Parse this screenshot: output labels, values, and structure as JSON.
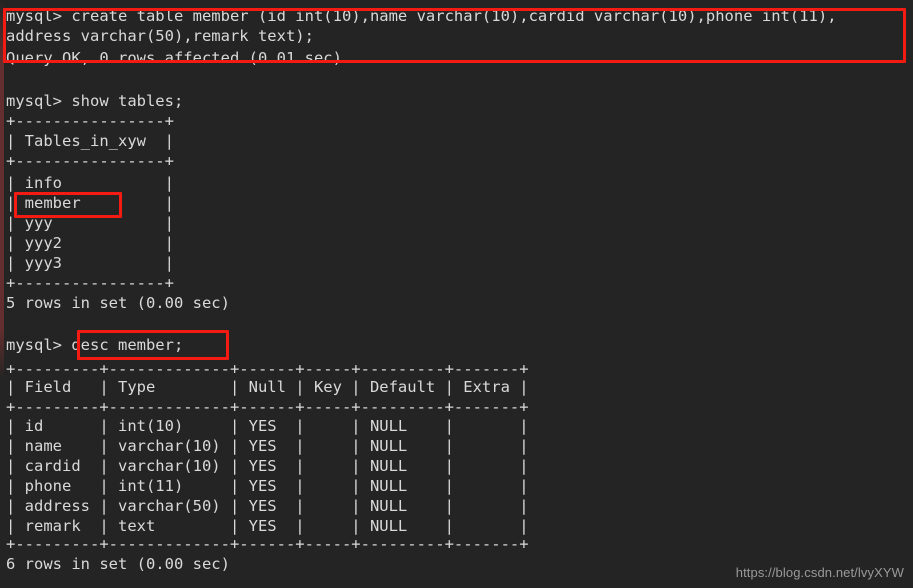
{
  "terminal": {
    "title": "mysql client session",
    "background_color": "#242424",
    "text_color": "#d9d9d9",
    "annotation_color": "#f41b12",
    "lines": [
      {
        "id": "l1",
        "text": "mysql> create table member (id int(10),name varchar(10),cardid varchar(10),phone int(11),"
      },
      {
        "id": "l2",
        "text": "address varchar(50),remark text);"
      },
      {
        "id": "l3",
        "text": "Query OK, 0 rows affected (0.01 sec)"
      },
      {
        "id": "l4",
        "text": ""
      },
      {
        "id": "l5",
        "text": "mysql> show tables;"
      },
      {
        "id": "l6",
        "text": "+----------------+"
      },
      {
        "id": "l7",
        "text": "| Tables_in_xyw  |"
      },
      {
        "id": "l8",
        "text": "+----------------+"
      },
      {
        "id": "l9",
        "text": "| info           |"
      },
      {
        "id": "l10",
        "text": "| member         |"
      },
      {
        "id": "l11",
        "text": "| yyy            |"
      },
      {
        "id": "l12",
        "text": "| yyy2           |"
      },
      {
        "id": "l13",
        "text": "| yyy3           |"
      },
      {
        "id": "l14",
        "text": "+----------------+"
      },
      {
        "id": "l15",
        "text": "5 rows in set (0.00 sec)"
      },
      {
        "id": "l16",
        "text": ""
      },
      {
        "id": "l17",
        "text": "mysql> desc member;"
      },
      {
        "id": "l18",
        "text": "+---------+-------------+------+-----+---------+-------+"
      },
      {
        "id": "l19",
        "text": "| Field   | Type        | Null | Key | Default | Extra |"
      },
      {
        "id": "l20",
        "text": "+---------+-------------+------+-----+---------+-------+"
      },
      {
        "id": "l21",
        "text": "| id      | int(10)     | YES  |     | NULL    |       |"
      },
      {
        "id": "l22",
        "text": "| name    | varchar(10) | YES  |     | NULL    |       |"
      },
      {
        "id": "l23",
        "text": "| cardid  | varchar(10) | YES  |     | NULL    |       |"
      },
      {
        "id": "l24",
        "text": "| phone   | int(11)     | YES  |     | NULL    |       |"
      },
      {
        "id": "l25",
        "text": "| address | varchar(50) | YES  |     | NULL    |       |"
      },
      {
        "id": "l26",
        "text": "| remark  | text        | YES  |     | NULL    |       |"
      },
      {
        "id": "l27",
        "text": "+---------+-------------+------+-----+---------+-------+"
      },
      {
        "id": "l28",
        "text": "6 rows in set (0.00 sec)"
      }
    ],
    "commands": {
      "create_table": "create table member (id int(10),name varchar(10),cardid varchar(10),phone int(11),address varchar(50),remark text);",
      "show_tables": "show tables;",
      "desc_member": "desc member;"
    },
    "prompt": "mysql>",
    "show_tables_result": {
      "column_header": "Tables_in_xyw",
      "rows": [
        "info",
        "member",
        "yyy",
        "yyy2",
        "yyy3"
      ],
      "footer": "5 rows in set (0.00 sec)"
    },
    "desc_member_result": {
      "headers": [
        "Field",
        "Type",
        "Null",
        "Key",
        "Default",
        "Extra"
      ],
      "rows": [
        [
          "id",
          "int(10)",
          "YES",
          "",
          "NULL",
          ""
        ],
        [
          "name",
          "varchar(10)",
          "YES",
          "",
          "NULL",
          ""
        ],
        [
          "cardid",
          "varchar(10)",
          "YES",
          "",
          "NULL",
          ""
        ],
        [
          "phone",
          "int(11)",
          "YES",
          "",
          "NULL",
          ""
        ],
        [
          "address",
          "varchar(50)",
          "YES",
          "",
          "NULL",
          ""
        ],
        [
          "remark",
          "text",
          "YES",
          "",
          "NULL",
          ""
        ]
      ],
      "footer": "6 rows in set (0.00 sec)"
    },
    "create_table_result": "Query OK, 0 rows affected (0.01 sec)"
  },
  "annotations": [
    {
      "id": "a1",
      "label": "create-table-statement"
    },
    {
      "id": "a2",
      "label": "member-table-row"
    },
    {
      "id": "a3",
      "label": "desc-member-command"
    }
  ],
  "watermark": {
    "text": "https://blog.csdn.net/lvyXYW"
  }
}
